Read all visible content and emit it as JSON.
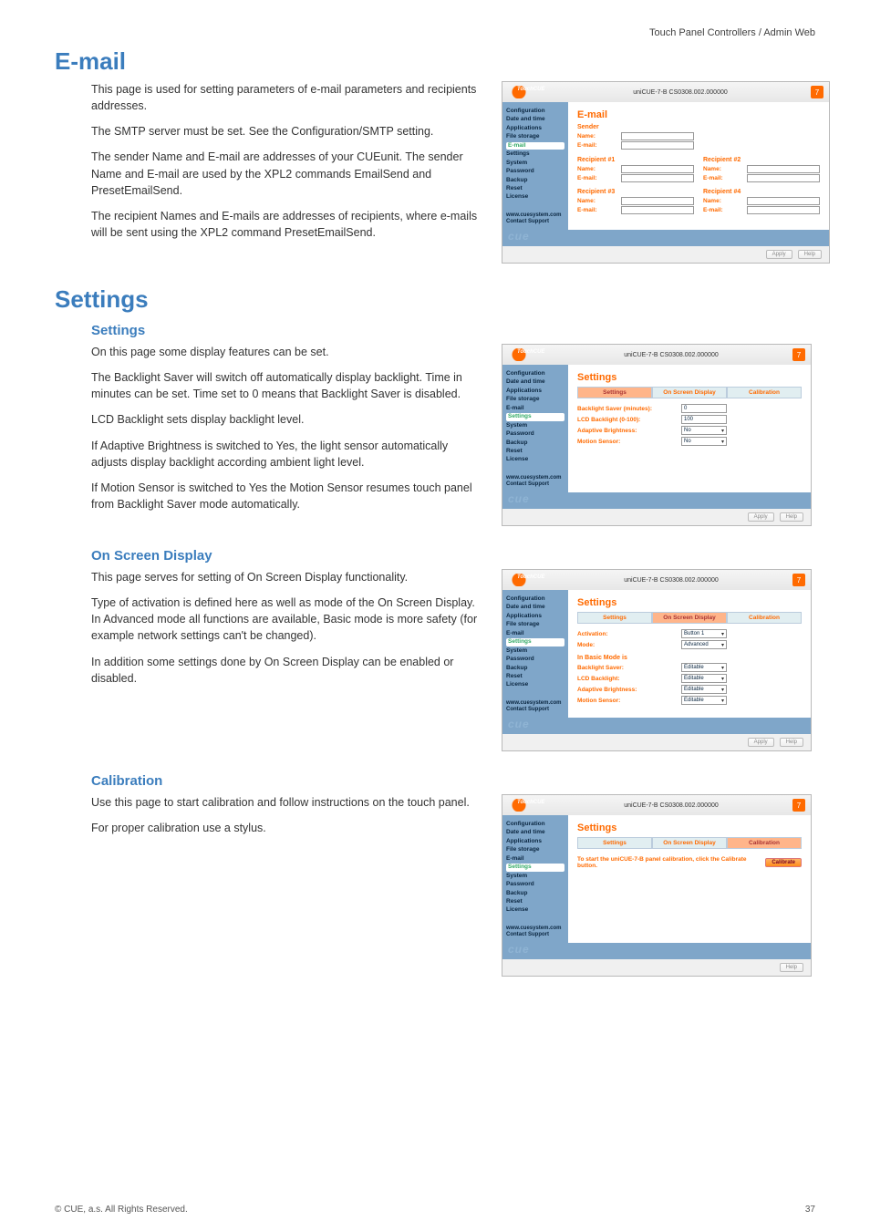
{
  "breadcrumb": "Touch Panel Controllers / Admin Web",
  "sections": {
    "email": {
      "title": "E-mail",
      "p1": "This page is used for setting parameters of e-mail parameters and recipients addresses.",
      "p2": "The SMTP server must be set. See the Configuration/SMTP setting.",
      "p3": "The sender Name and E-mail are addresses of your CUEunit. The sender Name and E-mail are used by the XPL2 commands EmailSend and PresetEmailSend.",
      "p4": "The recipient Names and E-mails are addresses of recipients, where e-mails will be sent using the XPL2 command PresetEmailSend."
    },
    "settings": {
      "title": "Settings",
      "sub1": "Settings",
      "s1p1": "On this page some display features can be set.",
      "s1p2": "The Backlight Saver will switch off automatically display backlight. Time in minutes can be set. Time set to 0 means that Backlight Saver is disabled.",
      "s1p3": "LCD Backlight sets display backlight level.",
      "s1p4": "If Adaptive Brightness is switched to Yes, the light sensor automatically adjusts display backlight according ambient light level.",
      "s1p5": "If Motion Sensor is switched to Yes the Motion Sensor resumes touch panel from Backlight Saver mode automatically.",
      "sub2": "On Screen Display",
      "s2p1": "This page serves for setting of On Screen Display functionality.",
      "s2p2": "Type of activation is defined here as well as mode of the On Screen Display. In Advanced mode all functions are available, Basic mode is more safety (for example network settings can't be changed).",
      "s2p3": "In addition some settings done by On Screen Display can be enabled or disabled.",
      "sub3": "Calibration",
      "s3p1": "Use this page to start calibration and follow instructions on the touch panel.",
      "s3p2": "For proper calibration use a stylus."
    }
  },
  "shot_common": {
    "device": "uniCUE-7-B  CS0308.002.000000",
    "badge": "7",
    "nav": [
      "Configuration",
      "Date and time",
      "Applications",
      "File storage",
      "E-mail",
      "Settings",
      "System",
      "Password",
      "Backup",
      "Reset",
      "License"
    ],
    "nav_footer1": "www.cuesystem.com",
    "nav_footer2": "Contact Support",
    "btn_apply": "Apply",
    "btn_help": "Help"
  },
  "shot_email": {
    "title": "E-mail",
    "sender": "Sender",
    "name": "Name:",
    "emailLab": "E-mail:",
    "r1": "Recipient #1",
    "r2": "Recipient #2",
    "r3": "Recipient #3",
    "r4": "Recipient #4"
  },
  "shot_settings": {
    "title": "Settings",
    "tabs": [
      "Settings",
      "On Screen Display",
      "Calibration"
    ],
    "rows": {
      "backlight_saver": {
        "label": "Backlight Saver (minutes):",
        "value": "0"
      },
      "lcd_backlight": {
        "label": "LCD Backlight (0-100):",
        "value": "100"
      },
      "adaptive": {
        "label": "Adaptive Brightness:",
        "value": "No"
      },
      "motion": {
        "label": "Motion Sensor:",
        "value": "No"
      }
    }
  },
  "shot_osd": {
    "title": "Settings",
    "tabs": [
      "Settings",
      "On Screen Display",
      "Calibration"
    ],
    "rows": {
      "activation": {
        "label": "Activation:",
        "value": "Button 1"
      },
      "mode": {
        "label": "Mode:",
        "value": "Advanced"
      },
      "basic_hdr": "In Basic Mode is",
      "bls": {
        "label": "Backlight Saver:",
        "value": "Editable"
      },
      "lcdb": {
        "label": "LCD Backlight:",
        "value": "Editable"
      },
      "ab": {
        "label": "Adaptive Brightness:",
        "value": "Editable"
      },
      "ms": {
        "label": "Motion Sensor:",
        "value": "Editable"
      }
    }
  },
  "shot_calib": {
    "title": "Settings",
    "tabs": [
      "Settings",
      "On Screen Display",
      "Calibration"
    ],
    "text": "To start the uniCUE-7-B panel calibration, click the Calibrate button.",
    "btn": "Calibrate"
  },
  "footer": {
    "left": "© CUE, a.s. All Rights Reserved.",
    "right": "37"
  }
}
